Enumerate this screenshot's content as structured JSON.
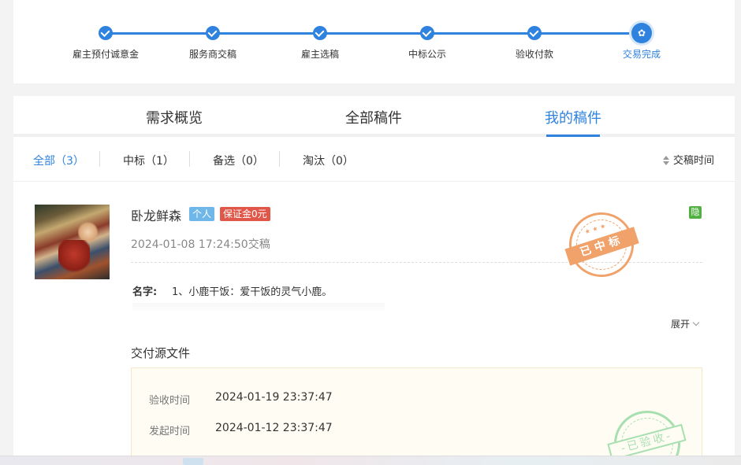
{
  "progress": {
    "steps": [
      {
        "label": "雇主预付诚意金"
      },
      {
        "label": "服务商交稿"
      },
      {
        "label": "雇主选稿"
      },
      {
        "label": "中标公示"
      },
      {
        "label": "验收付款"
      },
      {
        "label": "交易完成"
      }
    ],
    "accent": "#2f82de"
  },
  "tabs": [
    {
      "label": "需求概览"
    },
    {
      "label": "全部稿件"
    },
    {
      "label": "我的稿件"
    }
  ],
  "filters": {
    "all": "全部（3）",
    "won": "中标（1）",
    "shortlist": "备选（0）",
    "eliminated": "淘汰（0）",
    "sort_label": "交稿时间"
  },
  "entry": {
    "username": "卧龙鲜森",
    "badge_personal": "个人",
    "badge_deposit": "保证金0元",
    "hidden_mark": "隐",
    "submit_time": "2024-01-08 17:24:50交稿",
    "stamp_won": "已中标",
    "name_label": "名字:",
    "name_text": "1、小鹿干饭：爱干饭的灵气小鹿。",
    "expand_label": "展开",
    "deliver_title": "交付源文件",
    "accept_time_label": "验收时间",
    "accept_time_value": "2024-01-19 23:37:47",
    "start_time_label": "发起时间",
    "start_time_value": "2024-01-12 23:37:47",
    "stamp_accepted": "-已验收-"
  }
}
